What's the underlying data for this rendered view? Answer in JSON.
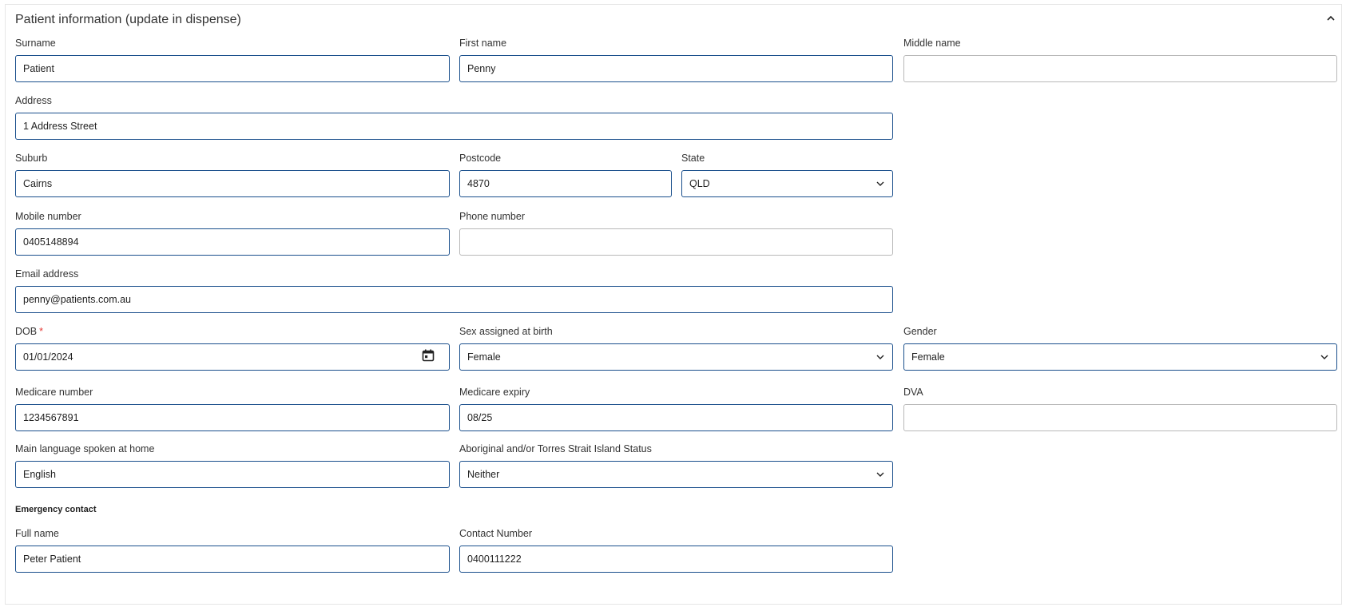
{
  "panel": {
    "title": "Patient information (update in dispense)",
    "collapse_icon": "chevron-up-icon"
  },
  "fields": {
    "surname": {
      "label": "Surname",
      "value": "Patient"
    },
    "first_name": {
      "label": "First name",
      "value": "Penny"
    },
    "middle_name": {
      "label": "Middle name",
      "value": ""
    },
    "address": {
      "label": "Address",
      "value": "1 Address Street"
    },
    "suburb": {
      "label": "Suburb",
      "value": "Cairns"
    },
    "postcode": {
      "label": "Postcode",
      "value": "4870"
    },
    "state": {
      "label": "State",
      "value": "QLD"
    },
    "mobile": {
      "label": "Mobile number",
      "value": "0405148894"
    },
    "phone": {
      "label": "Phone number",
      "value": ""
    },
    "email": {
      "label": "Email address",
      "value": "penny@patients.com.au"
    },
    "dob": {
      "label": "DOB",
      "required_mark": "*",
      "value": "01/01/2024",
      "icon": "calendar-icon"
    },
    "sex_at_birth": {
      "label": "Sex assigned at birth",
      "value": "Female"
    },
    "gender": {
      "label": "Gender",
      "value": "Female"
    },
    "medicare_number": {
      "label": "Medicare number",
      "value": "1234567891"
    },
    "medicare_expiry": {
      "label": "Medicare expiry",
      "value": "08/25"
    },
    "dva": {
      "label": "DVA",
      "value": ""
    },
    "language": {
      "label": "Main language spoken at home",
      "value": "English"
    },
    "atsi_status": {
      "label": "Aboriginal and/or Torres Strait Island Status",
      "value": "Neither"
    }
  },
  "emergency": {
    "heading": "Emergency contact",
    "full_name": {
      "label": "Full name",
      "value": "Peter Patient"
    },
    "contact_number": {
      "label": "Contact Number",
      "value": "0400111222"
    }
  },
  "colors": {
    "active_border": "#1a4f8c",
    "empty_border": "#b8b8b8",
    "required": "#e53935"
  }
}
